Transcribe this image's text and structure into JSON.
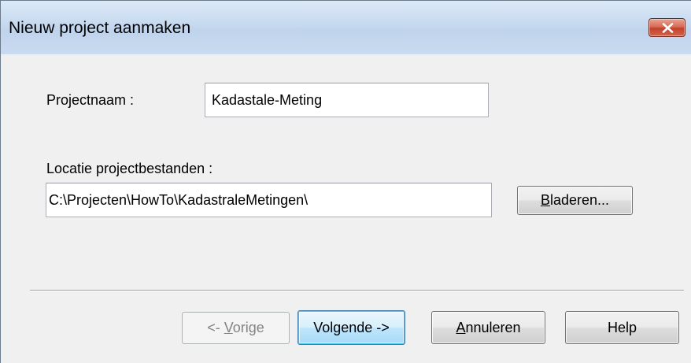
{
  "window": {
    "title": "Nieuw project aanmaken"
  },
  "form": {
    "project_name_label": "Projectnaam :",
    "project_name_value": "Kadastale-Meting",
    "location_label": "Locatie projectbestanden :",
    "location_value": "C:\\Projecten\\HowTo\\KadastraleMetingen\\",
    "browse_button": {
      "prefix": "",
      "underlined": "B",
      "rest": "laderen..."
    }
  },
  "buttons": {
    "previous": {
      "prefix": "<- ",
      "underlined": "V",
      "rest": "orige"
    },
    "next": {
      "prefix": "",
      "underlined": "",
      "rest": "Volgende ->"
    },
    "cancel": {
      "prefix": "",
      "underlined": "A",
      "rest": "nnuleren"
    },
    "help": {
      "prefix": "",
      "underlined": "",
      "rest": "Help"
    }
  },
  "colors": {
    "titlebar": "#c6d9ef",
    "close_button": "#c2412b",
    "default_button_border": "#3c7fb1",
    "dialog_background": "#f0f0f0"
  },
  "icons": {
    "close": "close-icon"
  }
}
